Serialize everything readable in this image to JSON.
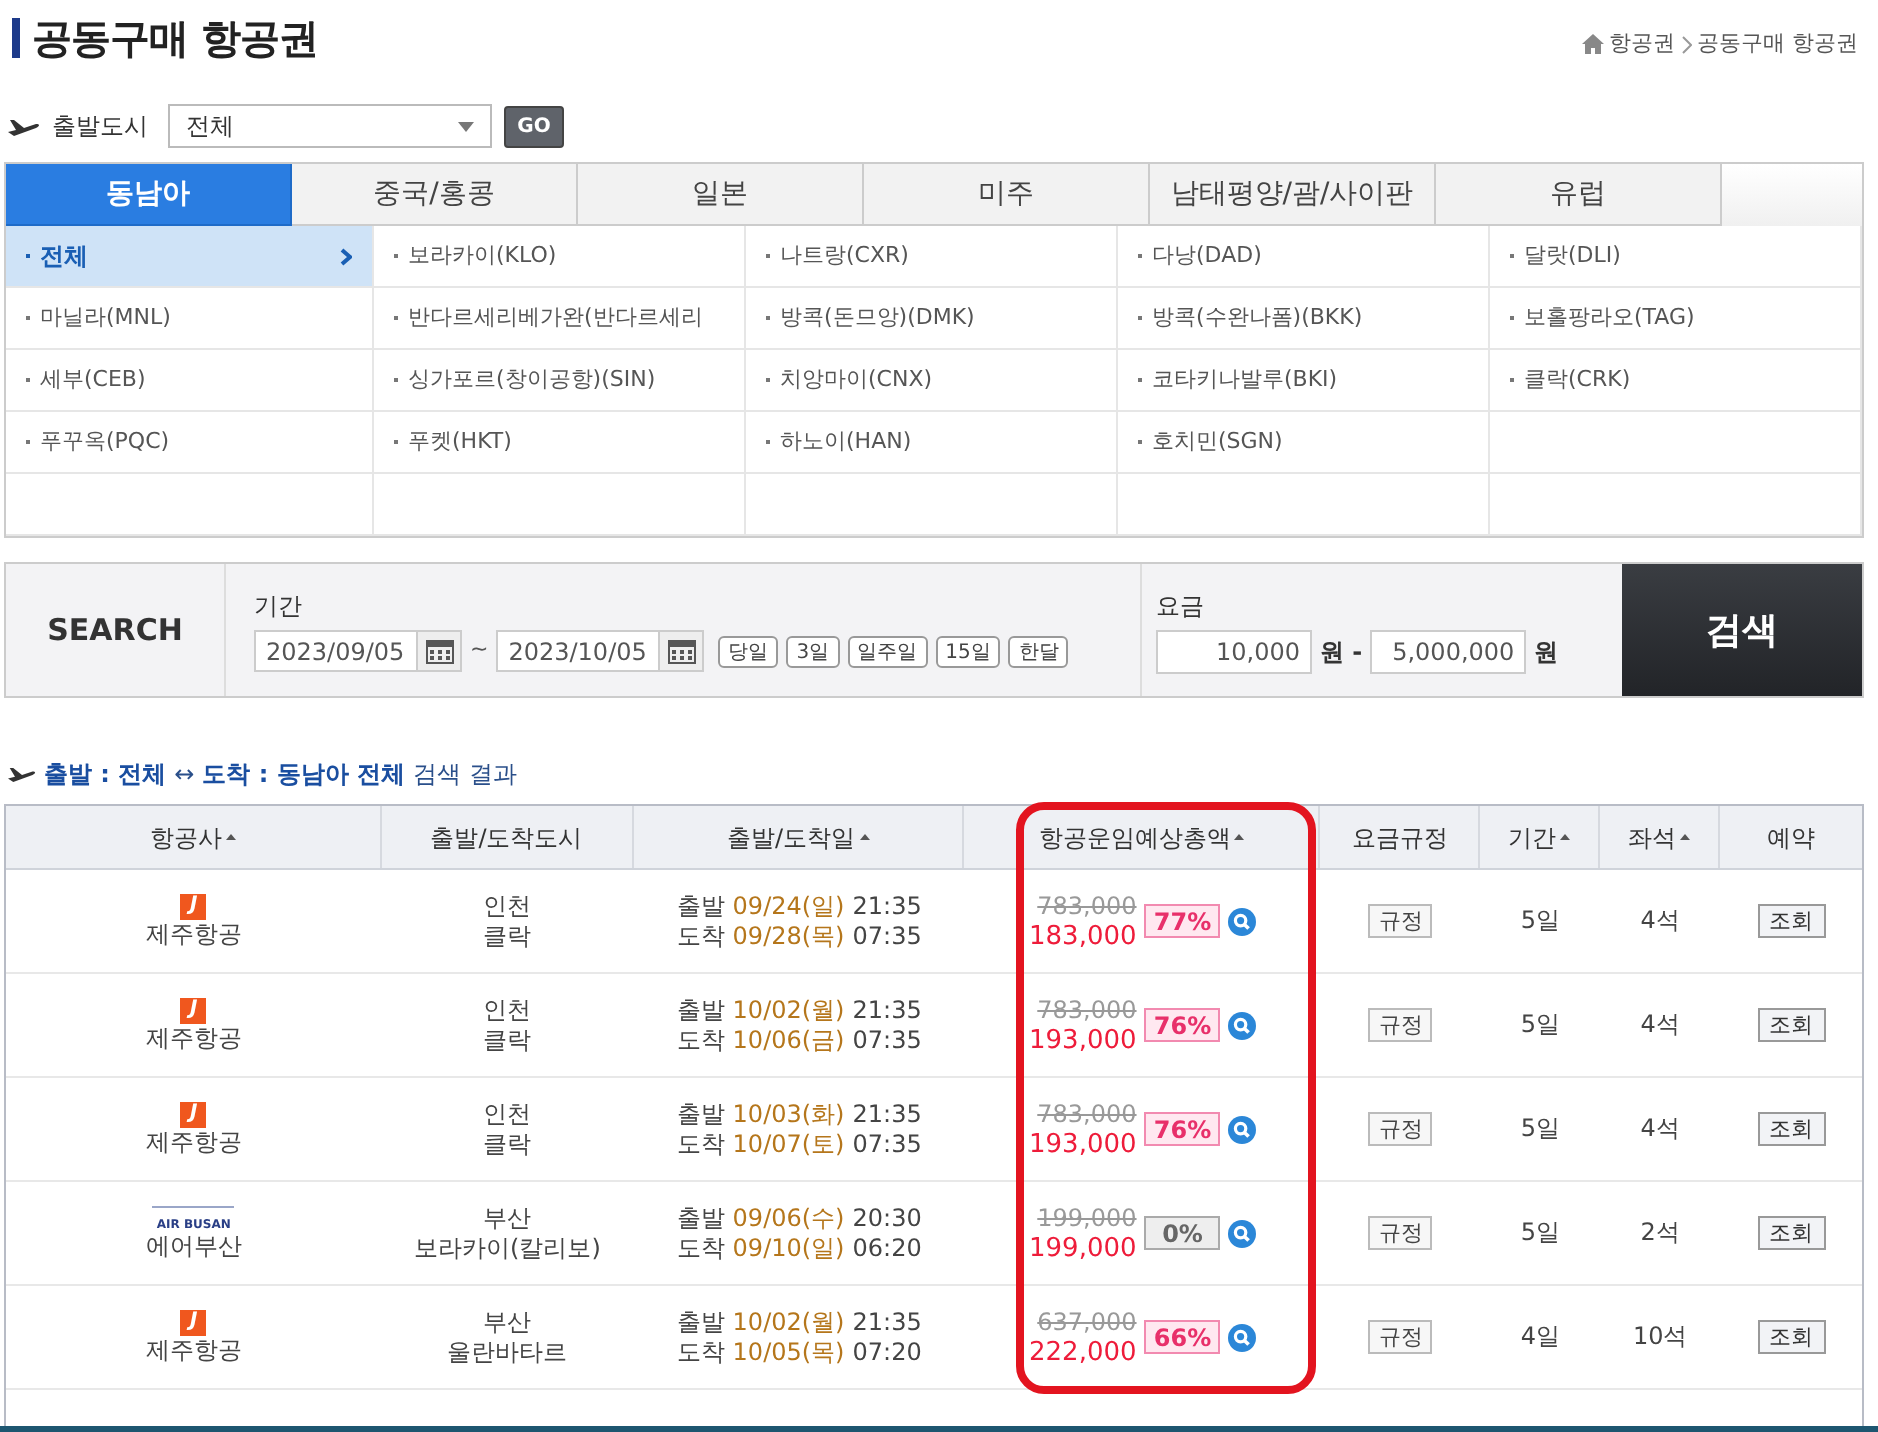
{
  "page_title": "공동구매 항공권",
  "breadcrumb": [
    "항공권",
    "공동구매 항공권"
  ],
  "departure": {
    "label": "출발도시",
    "value": "전체",
    "go": "GO"
  },
  "tabs": [
    {
      "label": "동남아",
      "selected": true
    },
    {
      "label": "중국/홍콩",
      "selected": false
    },
    {
      "label": "일본",
      "selected": false
    },
    {
      "label": "미주",
      "selected": false
    },
    {
      "label": "남태평양/괌/사이판",
      "selected": false
    },
    {
      "label": "유럽",
      "selected": false
    }
  ],
  "cities": [
    {
      "label": "전체",
      "selected": true
    },
    {
      "label": "보라카이(KLO)",
      "selected": false
    },
    {
      "label": "나트랑(CXR)",
      "selected": false
    },
    {
      "label": "다낭(DAD)",
      "selected": false
    },
    {
      "label": "달랏(DLI)",
      "selected": false
    },
    {
      "label": "마닐라(MNL)",
      "selected": false
    },
    {
      "label": "반다르세리베가완(반다르세리",
      "selected": false
    },
    {
      "label": "방콕(돈므앙)(DMK)",
      "selected": false
    },
    {
      "label": "방콕(수완나폼)(BKK)",
      "selected": false
    },
    {
      "label": "보홀팡라오(TAG)",
      "selected": false
    },
    {
      "label": "세부(CEB)",
      "selected": false
    },
    {
      "label": "싱가포르(창이공항)(SIN)",
      "selected": false
    },
    {
      "label": "치앙마이(CNX)",
      "selected": false
    },
    {
      "label": "코타키나발루(BKI)",
      "selected": false
    },
    {
      "label": "클락(CRK)",
      "selected": false
    },
    {
      "label": "푸꾸옥(PQC)",
      "selected": false
    },
    {
      "label": "푸켓(HKT)",
      "selected": false
    },
    {
      "label": "하노이(HAN)",
      "selected": false
    },
    {
      "label": "호치민(SGN)",
      "selected": false
    }
  ],
  "search": {
    "label": "SEARCH",
    "period_label": "기간",
    "date_from": "2023/09/05",
    "tilde": "~",
    "date_to": "2023/10/05",
    "quick_ranges": [
      "당일",
      "3일",
      "일주일",
      "15일",
      "한달"
    ],
    "fare_label": "요금",
    "fare_min": "10,000",
    "unit_1": "원 -",
    "fare_max": "5,000,000",
    "unit_2": "원",
    "submit": "검색"
  },
  "results_title": [
    {
      "text": "출발 : 전체",
      "kind": "link"
    },
    {
      "text": "↔",
      "kind": "plain"
    },
    {
      "text": "도착 : 동남아 전체",
      "kind": "link"
    },
    {
      "text": "검색 결과",
      "kind": "plain"
    }
  ],
  "table": {
    "columns": [
      {
        "label": "항공사",
        "sortable": true
      },
      {
        "label": "출발/도착도시",
        "sortable": false
      },
      {
        "label": "출발/도착일",
        "sortable": true
      },
      {
        "label": "항공운임예상총액",
        "sortable": true
      },
      {
        "label": "요금규정",
        "sortable": false
      },
      {
        "label": "기간",
        "sortable": true
      },
      {
        "label": "좌석",
        "sortable": true
      },
      {
        "label": "예약",
        "sortable": false
      }
    ],
    "rows": [
      {
        "logo": {
          "kind": "tile",
          "text": "J"
        },
        "airline": "제주항공",
        "from": "인천",
        "to": "클락",
        "dep_label": "출발",
        "dep_date": "09/24(일)",
        "dep_time": "21:35",
        "arr_label": "도착",
        "arr_date": "09/28(목)",
        "arr_time": "07:35",
        "list_price": "783,000",
        "price": "183,000",
        "discount": "77%",
        "discounted": true,
        "rule": "규정",
        "days": "5일",
        "seats": "4석",
        "book": "조회"
      },
      {
        "logo": {
          "kind": "tile",
          "text": "J"
        },
        "airline": "제주항공",
        "from": "인천",
        "to": "클락",
        "dep_label": "출발",
        "dep_date": "10/02(월)",
        "dep_time": "21:35",
        "arr_label": "도착",
        "arr_date": "10/06(금)",
        "arr_time": "07:35",
        "list_price": "783,000",
        "price": "193,000",
        "discount": "76%",
        "discounted": true,
        "rule": "규정",
        "days": "5일",
        "seats": "4석",
        "book": "조회"
      },
      {
        "logo": {
          "kind": "tile",
          "text": "J"
        },
        "airline": "제주항공",
        "from": "인천",
        "to": "클락",
        "dep_label": "출발",
        "dep_date": "10/03(화)",
        "dep_time": "21:35",
        "arr_label": "도착",
        "arr_date": "10/07(토)",
        "arr_time": "07:35",
        "list_price": "783,000",
        "price": "193,000",
        "discount": "76%",
        "discounted": true,
        "rule": "규정",
        "days": "5일",
        "seats": "4석",
        "book": "조회"
      },
      {
        "logo": {
          "kind": "wordmark",
          "text": "AIR BUSAN"
        },
        "airline": "에어부산",
        "from": "부산",
        "to": "보라카이(칼리보)",
        "dep_label": "출발",
        "dep_date": "09/06(수)",
        "dep_time": "20:30",
        "arr_label": "도착",
        "arr_date": "09/10(일)",
        "arr_time": "06:20",
        "list_price": "199,000",
        "price": "199,000",
        "discount": "0%",
        "discounted": false,
        "rule": "규정",
        "days": "5일",
        "seats": "2석",
        "book": "조회"
      },
      {
        "logo": {
          "kind": "tile",
          "text": "J"
        },
        "airline": "제주항공",
        "from": "부산",
        "to": "울란바타르",
        "dep_label": "출발",
        "dep_date": "10/02(월)",
        "dep_time": "21:35",
        "arr_label": "도착",
        "arr_date": "10/05(목)",
        "arr_time": "07:20",
        "list_price": "637,000",
        "price": "222,000",
        "discount": "66%",
        "discounted": true,
        "rule": "규정",
        "days": "4일",
        "seats": "10석",
        "book": "조회"
      }
    ]
  }
}
